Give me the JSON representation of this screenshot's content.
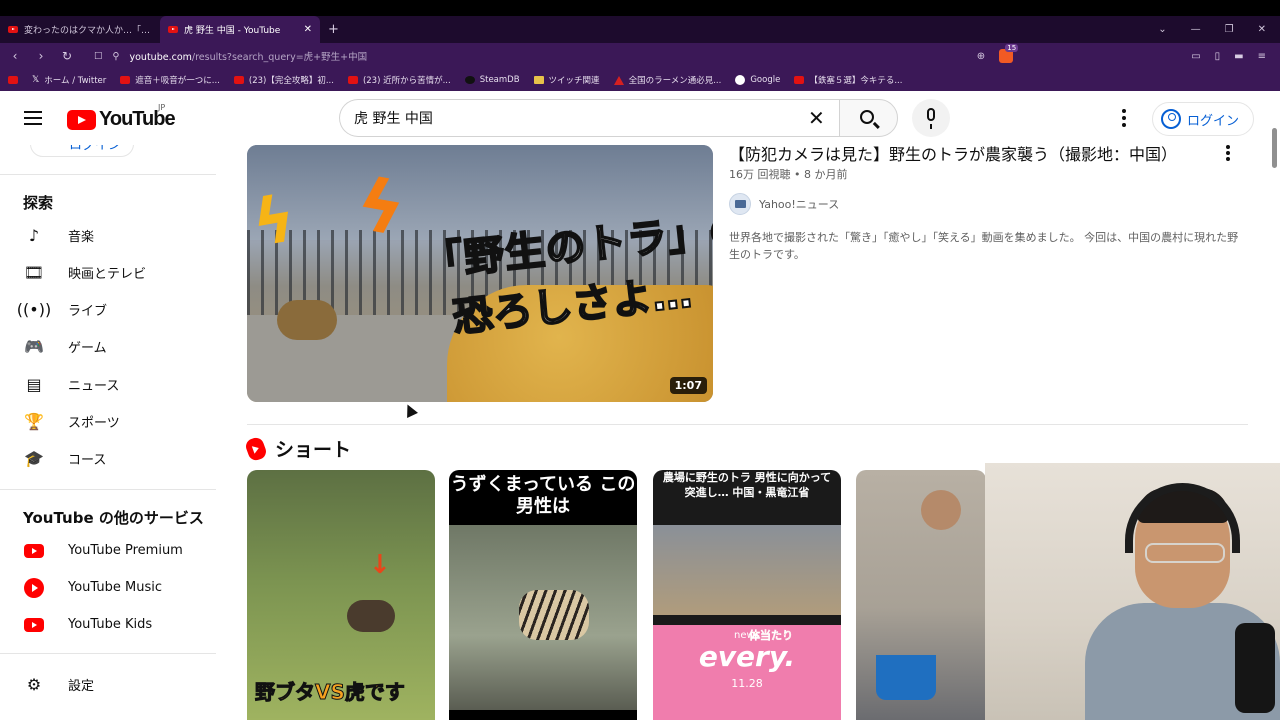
{
  "browser": {
    "tabs": [
      {
        "title": "変わったのはクマか人か…「ヒグマの人慣れ",
        "active": false
      },
      {
        "title": "虎 野生 中国 - YouTube",
        "active": true
      }
    ],
    "new_tab": "+",
    "url_host": "youtube.com",
    "url_path": "/results?search_query=虎+野生+中国",
    "brave_badge": "15",
    "bookmarks": [
      {
        "label": "",
        "icon": "youtube-icon"
      },
      {
        "label": "ホーム / Twitter",
        "icon": "x-icon"
      },
      {
        "label": "遮音＋吸音が一つに...",
        "icon": "bookmark-icon"
      },
      {
        "label": "(23)【完全攻略】初...",
        "icon": "youtube-icon"
      },
      {
        "label": "(23) 近所から苦情が...",
        "icon": "youtube-icon"
      },
      {
        "label": "SteamDB",
        "icon": "steam-icon"
      },
      {
        "label": "ツイッチ関連",
        "icon": "folder-icon"
      },
      {
        "label": "全国のラーメン通必見...",
        "icon": "ramen-icon"
      },
      {
        "label": "Google",
        "icon": "google-icon"
      },
      {
        "label": "【鉄塞５選】今キテる...",
        "icon": "youtube-icon"
      }
    ]
  },
  "header": {
    "logo_text": "YouTube",
    "region": "JP",
    "search_value": "虎 野生 中国",
    "login_label": "ログイン"
  },
  "sidebar": {
    "partial_login": "ログイン",
    "explore_title": "探索",
    "explore_items": [
      {
        "label": "音楽",
        "icon": "music-note-icon"
      },
      {
        "label": "映画とテレビ",
        "icon": "film-icon"
      },
      {
        "label": "ライブ",
        "icon": "live-icon"
      },
      {
        "label": "ゲーム",
        "icon": "gamepad-icon"
      },
      {
        "label": "ニュース",
        "icon": "news-icon"
      },
      {
        "label": "スポーツ",
        "icon": "trophy-icon"
      },
      {
        "label": "コース",
        "icon": "course-icon"
      }
    ],
    "services_title": "YouTube の他のサービス",
    "services": [
      {
        "label": "YouTube Premium",
        "icon": "youtube-premium-icon"
      },
      {
        "label": "YouTube Music",
        "icon": "youtube-music-icon"
      },
      {
        "label": "YouTube Kids",
        "icon": "youtube-kids-icon"
      }
    ],
    "settings_label": "設定"
  },
  "video": {
    "title": "【防犯カメラは見た】野生のトラが農家襲う（撮影地：中国）",
    "meta": "16万 回視聴 • 8 か月前",
    "channel": "Yahoo!ニュース",
    "description": "世界各地で撮影された「驚き」「癒やし」「笑える」動画を集めました。 今回は、中国の農村に現れた野生のトラです。",
    "duration": "1:07",
    "thumb_caption_1": "「野生のトラ」の",
    "thumb_caption_2": "恐ろしさよ…"
  },
  "shorts": {
    "title": "ショート",
    "items": [
      {
        "caption": "野ブタVS虎です"
      },
      {
        "caption": "うずくまっている この男性は"
      },
      {
        "caption": "農場に野生のトラ 男性に向かって突進し… 中国・黒竜江省",
        "news": "news",
        "every": "every.",
        "date": "11.28",
        "tag": "体当たり"
      },
      {
        "caption": ""
      }
    ]
  },
  "colors": {
    "accent": "#065fd4",
    "brand_red": "#ff0000",
    "chrome_purple": "#3b1857"
  }
}
